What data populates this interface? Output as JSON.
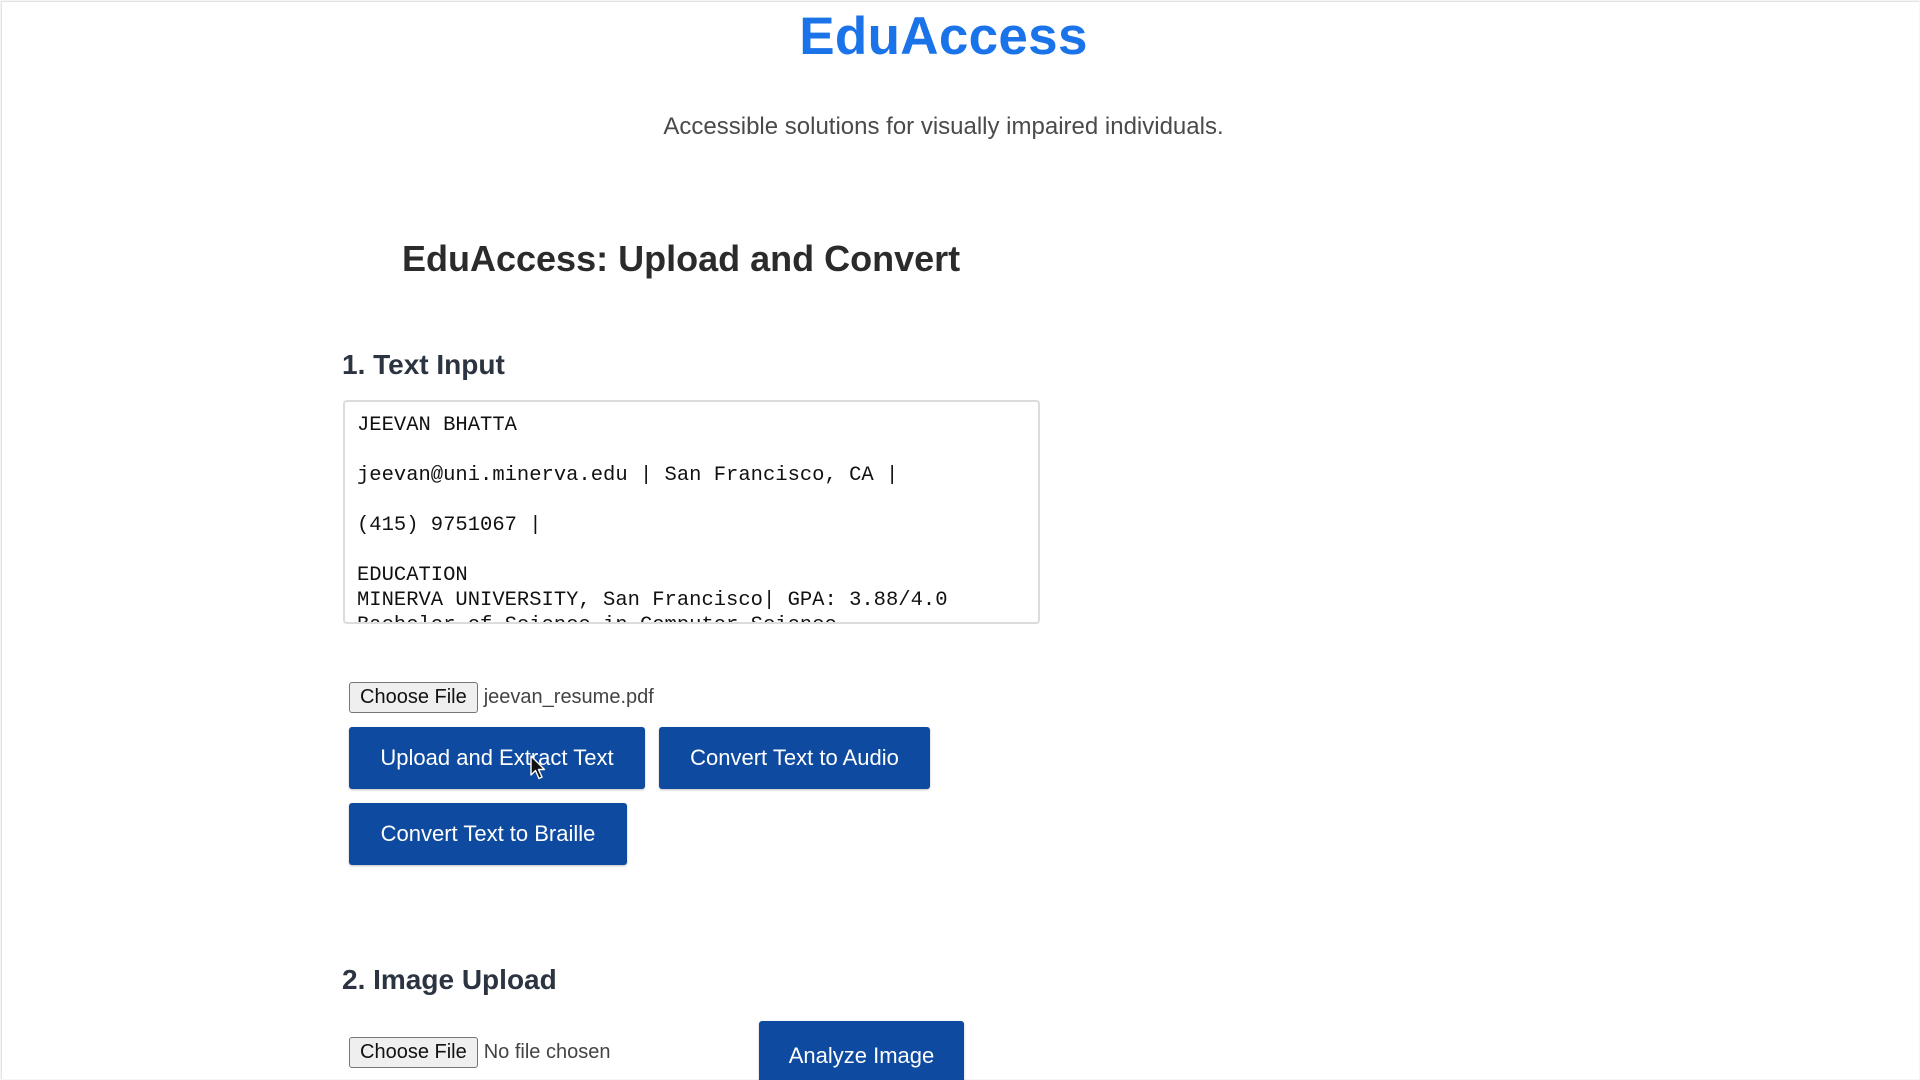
{
  "header": {
    "title": "EduAccess",
    "tagline": "Accessible solutions for visually impaired individuals."
  },
  "main": {
    "section_title": "EduAccess: Upload and Convert",
    "text_input": {
      "heading": "1. Text Input",
      "value": "JEEVAN BHATTA\n\njeevan@uni.minerva.edu | San Francisco, CA |\n\n(415) 9751067 |\n\nEDUCATION\nMINERVA UNIVERSITY, San Francisco| GPA: 3.88/4.0\nBachelor of Science in Computer Science",
      "file_button_label": "Choose File",
      "file_name": "jeevan_resume.pdf",
      "upload_button_label": "Upload and Extract Text",
      "audio_button_label": "Convert Text to Audio",
      "braille_button_label": "Convert Text to Braille"
    },
    "image_upload": {
      "heading": "2. Image Upload",
      "file_button_label": "Choose File",
      "file_name": "No file chosen",
      "analyze_button_label": "Analyze Image"
    }
  },
  "colors": {
    "brand": "#1a73e8",
    "button": "#0d4aa0",
    "heading": "#2b2b2b"
  },
  "icons": {
    "cursor": "mouse-pointer-icon"
  }
}
